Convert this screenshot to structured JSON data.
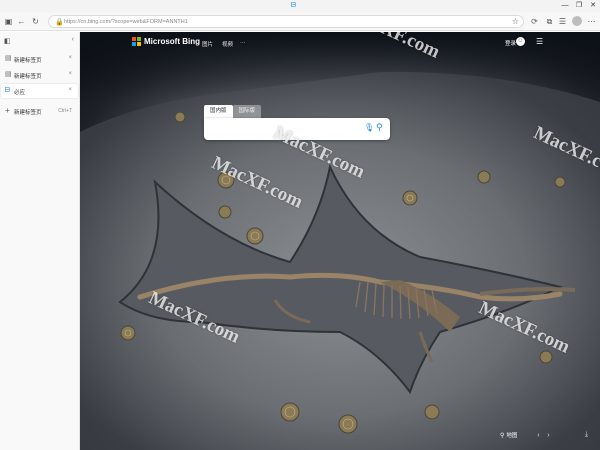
{
  "window": {
    "tab_icon": "bing-b-icon",
    "controls": [
      "—",
      "❐",
      "✕"
    ]
  },
  "toolbar": {
    "url": "cn.bing.com/?scope=web&FORM=ANNTH1",
    "url_prefix": "https://",
    "icons": [
      "tab-actions-icon",
      "back-icon",
      "refresh-icon",
      "favorites-star-icon",
      "reading-icon",
      "collections-icon",
      "extensions-icon",
      "profile-icon",
      "more-icon"
    ]
  },
  "sidebar": {
    "tabs": [
      {
        "label": "新建标签页",
        "close": "×",
        "active": false
      },
      {
        "label": "新建标签页",
        "close": "×",
        "active": false
      },
      {
        "label": "必应",
        "close": "×",
        "active": true
      }
    ],
    "new_tab_label": "新建标签页",
    "new_tab_shortcut": "Ctrl+T"
  },
  "bing": {
    "brand": "Microsoft Bing",
    "nav": [
      "图片",
      "视频",
      "···"
    ],
    "login": "登录",
    "search_tabs": [
      "国内版",
      "国际版"
    ],
    "search_placeholder": "",
    "location_label": "地图"
  },
  "watermark": "MacXF.com",
  "colors": {
    "accent": "#1e88e5",
    "ms_red": "#f35325",
    "ms_green": "#81bc06",
    "ms_blue": "#05a6f0",
    "ms_yellow": "#ffba08"
  }
}
